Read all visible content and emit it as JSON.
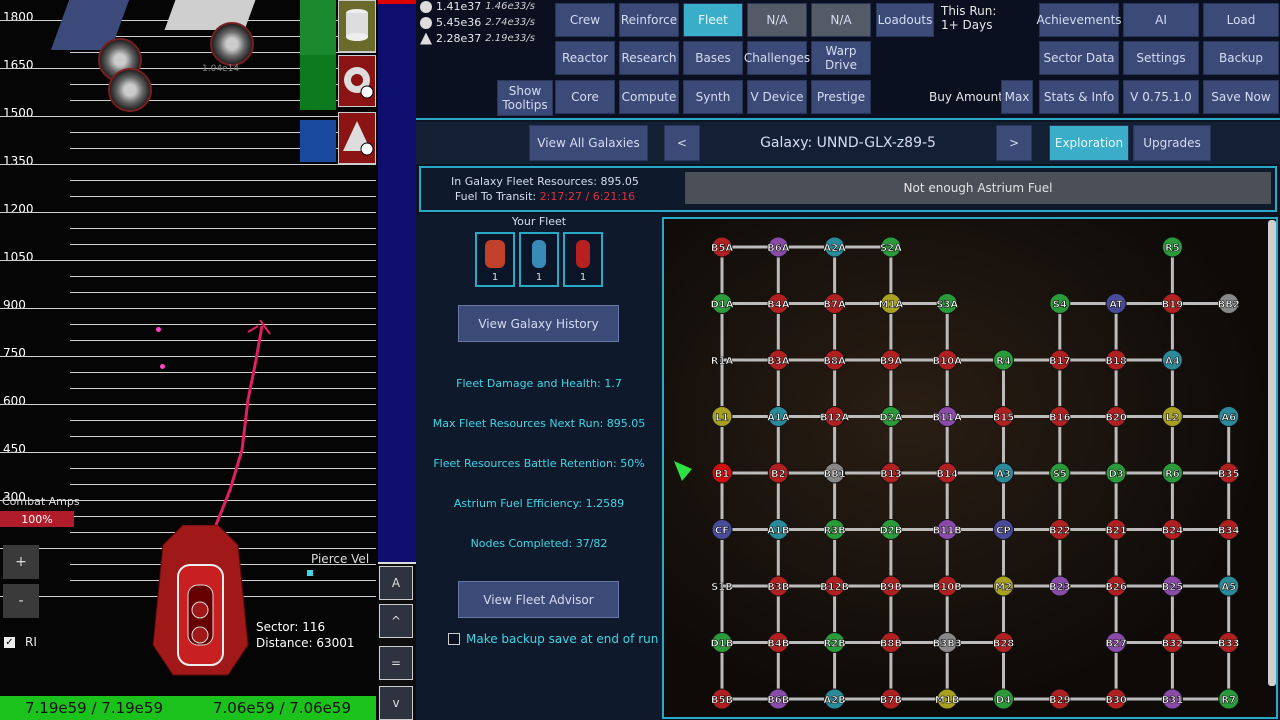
{
  "game": {
    "scale_labels": [
      "1800",
      "1650",
      "1500",
      "1350",
      "1200",
      "1050",
      "900",
      "750",
      "600",
      "450",
      "300"
    ],
    "enemy_hp_text": "1.04e14",
    "combat_amps_label": "Combat Amps",
    "combat_amps_value": "100%",
    "pierce_label": "Pierce Vel",
    "ctrl_plus": "+",
    "ctrl_minus": "-",
    "ri_label": "RI",
    "sector_text": "Sector: 116",
    "distance_text": "Distance: 63001",
    "hp_left": "7.19e59 / 7.19e59",
    "hp_right": "7.06e59 / 7.06e59",
    "side_buttons": [
      "A",
      "^",
      "=",
      "v"
    ]
  },
  "resources": [
    {
      "value": "1.41e37",
      "rate": "1.46e33/s",
      "icon": "database-icon"
    },
    {
      "value": "5.45e36",
      "rate": "2.74e33/s",
      "icon": "ore-icon"
    },
    {
      "value": "2.28e37",
      "rate": "2.19e33/s",
      "icon": "crystal-icon"
    }
  ],
  "nav": {
    "show_tooltips": "Show Tooltips",
    "crew": "Crew",
    "reinforce": "Reinforce",
    "fleet": "Fleet",
    "na1": "N/A",
    "na2": "N/A",
    "loadouts": "Loadouts",
    "reactor": "Reactor",
    "research": "Research",
    "bases": "Bases",
    "challenges": "Challenges",
    "warp_drive": "Warp Drive",
    "core": "Core",
    "compute": "Compute",
    "synth": "Synth",
    "v_device": "V Device",
    "prestige": "Prestige",
    "this_run_label": "This Run:",
    "this_run_value": "1+ Days",
    "achievements": "Achievements",
    "ai": "AI",
    "load": "Load",
    "sector_data": "Sector Data",
    "settings": "Settings",
    "backup": "Backup",
    "buy_amount_label": "Buy Amount:",
    "max": "Max",
    "stats_info": "Stats & Info",
    "version": "V 0.75.1.0",
    "save_now": "Save Now"
  },
  "galaxy": {
    "view_all": "View All Galaxies",
    "prev": "<",
    "title": "Galaxy: UNND-GLX-z89-5",
    "next": ">",
    "exploration": "Exploration",
    "upgrades": "Upgrades",
    "fleet_resources": "In Galaxy Fleet Resources: 895.05",
    "fuel_label": "Fuel To Transit: ",
    "fuel_value": "2:17:27 / 6:21:16",
    "not_enough": "Not enough Astrium Fuel",
    "your_fleet": "Your Fleet",
    "fleet_counts": [
      "1",
      "1",
      "1"
    ],
    "view_history": "View Galaxy History",
    "stats": [
      "Fleet Damage and Health: 1.7",
      "Max Fleet Resources Next Run: 895.05",
      "Fleet Resources Battle Retention: 50%",
      "Astrium Fuel Efficiency: 1.2589",
      "Nodes Completed: 37/82"
    ],
    "view_advisor": "View Fleet Advisor",
    "backup_label": "Make backup save at end of run"
  },
  "map_nodes": [
    {
      "id": "B5A",
      "c": "#b02020",
      "col": 0,
      "row": 0
    },
    {
      "id": "B6A",
      "c": "#8a4aa8",
      "col": 1,
      "row": 0
    },
    {
      "id": "A2A",
      "c": "#2a8a9a",
      "col": 2,
      "row": 0
    },
    {
      "id": "S2A",
      "c": "#2a9a3a",
      "col": 3,
      "row": 0
    },
    {
      "id": "R5",
      "c": "#2a9a3a",
      "col": 8,
      "row": 0
    },
    {
      "id": "D1A",
      "c": "#2a9a3a",
      "col": 0,
      "row": 1
    },
    {
      "id": "B4A",
      "c": "#b02020",
      "col": 1,
      "row": 1
    },
    {
      "id": "B7A",
      "c": "#b02020",
      "col": 2,
      "row": 1
    },
    {
      "id": "M1A",
      "c": "#a8a020",
      "col": 3,
      "row": 1
    },
    {
      "id": "S3A",
      "c": "#2a9a3a",
      "col": 4,
      "row": 1
    },
    {
      "id": "S4",
      "c": "#2a9a3a",
      "col": 6,
      "row": 1
    },
    {
      "id": "AT",
      "c": "#4a4a9a",
      "col": 7,
      "row": 1
    },
    {
      "id": "B19",
      "c": "#b02020",
      "col": 8,
      "row": 1
    },
    {
      "id": "BB2",
      "c": "#888",
      "col": 9,
      "row": 1
    },
    {
      "id": "R1A",
      "c": "none",
      "col": 0,
      "row": 2
    },
    {
      "id": "B3A",
      "c": "#b02020",
      "col": 1,
      "row": 2
    },
    {
      "id": "B8A",
      "c": "#b02020",
      "col": 2,
      "row": 2
    },
    {
      "id": "B9A",
      "c": "#b02020",
      "col": 3,
      "row": 2
    },
    {
      "id": "B10A",
      "c": "#b02020",
      "col": 4,
      "row": 2
    },
    {
      "id": "R4",
      "c": "#2a9a3a",
      "col": 5,
      "row": 2
    },
    {
      "id": "B17",
      "c": "#b02020",
      "col": 6,
      "row": 2
    },
    {
      "id": "B18",
      "c": "#b02020",
      "col": 7,
      "row": 2
    },
    {
      "id": "A4",
      "c": "#2a8a9a",
      "col": 8,
      "row": 2
    },
    {
      "id": "L1",
      "c": "#a8a020",
      "col": 0,
      "row": 3
    },
    {
      "id": "A1A",
      "c": "#2a8a9a",
      "col": 1,
      "row": 3
    },
    {
      "id": "B12A",
      "c": "#b02020",
      "col": 2,
      "row": 3
    },
    {
      "id": "D2A",
      "c": "#2a9a3a",
      "col": 3,
      "row": 3
    },
    {
      "id": "B11A",
      "c": "#8a4aa8",
      "col": 4,
      "row": 3
    },
    {
      "id": "B15",
      "c": "#b02020",
      "col": 5,
      "row": 3
    },
    {
      "id": "B16",
      "c": "#b02020",
      "col": 6,
      "row": 3
    },
    {
      "id": "B20",
      "c": "#b02020",
      "col": 7,
      "row": 3
    },
    {
      "id": "L2",
      "c": "#a8a020",
      "col": 8,
      "row": 3
    },
    {
      "id": "A6",
      "c": "#2a8a9a",
      "col": 9,
      "row": 3
    },
    {
      "id": "B1",
      "c": "#d01010",
      "col": 0,
      "row": 4
    },
    {
      "id": "B2",
      "c": "#b02020",
      "col": 1,
      "row": 4
    },
    {
      "id": "BB1",
      "c": "#888",
      "col": 2,
      "row": 4
    },
    {
      "id": "B13",
      "c": "#b02020",
      "col": 3,
      "row": 4
    },
    {
      "id": "B14",
      "c": "#b02020",
      "col": 4,
      "row": 4
    },
    {
      "id": "A3",
      "c": "#2a8a9a",
      "col": 5,
      "row": 4
    },
    {
      "id": "S5",
      "c": "#2a9a3a",
      "col": 6,
      "row": 4
    },
    {
      "id": "D3",
      "c": "#2a9a3a",
      "col": 7,
      "row": 4
    },
    {
      "id": "R6",
      "c": "#2a9a3a",
      "col": 8,
      "row": 4
    },
    {
      "id": "B35",
      "c": "#b02020",
      "col": 9,
      "row": 4
    },
    {
      "id": "CF",
      "c": "#4a4a9a",
      "col": 0,
      "row": 5
    },
    {
      "id": "A1B",
      "c": "#2a8a9a",
      "col": 1,
      "row": 5
    },
    {
      "id": "R3B",
      "c": "#2a9a3a",
      "col": 2,
      "row": 5
    },
    {
      "id": "D2B",
      "c": "#2a9a3a",
      "col": 3,
      "row": 5
    },
    {
      "id": "B11B",
      "c": "#8a4aa8",
      "col": 4,
      "row": 5
    },
    {
      "id": "CP",
      "c": "#4a4a9a",
      "col": 5,
      "row": 5
    },
    {
      "id": "B22",
      "c": "#b02020",
      "col": 6,
      "row": 5
    },
    {
      "id": "B21",
      "c": "#b02020",
      "col": 7,
      "row": 5
    },
    {
      "id": "B24",
      "c": "#b02020",
      "col": 8,
      "row": 5
    },
    {
      "id": "B34",
      "c": "#b02020",
      "col": 9,
      "row": 5
    },
    {
      "id": "S1B",
      "c": "none",
      "col": 0,
      "row": 6
    },
    {
      "id": "B3B",
      "c": "#b02020",
      "col": 1,
      "row": 6
    },
    {
      "id": "B12B",
      "c": "#b02020",
      "col": 2,
      "row": 6
    },
    {
      "id": "B9B",
      "c": "#b02020",
      "col": 3,
      "row": 6
    },
    {
      "id": "B10B",
      "c": "#b02020",
      "col": 4,
      "row": 6
    },
    {
      "id": "M2",
      "c": "#a8a020",
      "col": 5,
      "row": 6
    },
    {
      "id": "B23",
      "c": "#8a4aa8",
      "col": 6,
      "row": 6
    },
    {
      "id": "B26",
      "c": "#b02020",
      "col": 7,
      "row": 6
    },
    {
      "id": "B25",
      "c": "#8a4aa8",
      "col": 8,
      "row": 6
    },
    {
      "id": "A5",
      "c": "#2a8a9a",
      "col": 9,
      "row": 6
    },
    {
      "id": "D1B",
      "c": "#2a9a3a",
      "col": 0,
      "row": 7
    },
    {
      "id": "B4B",
      "c": "#b02020",
      "col": 1,
      "row": 7
    },
    {
      "id": "R2B",
      "c": "#2a9a3a",
      "col": 2,
      "row": 7
    },
    {
      "id": "B8B",
      "c": "#b02020",
      "col": 3,
      "row": 7
    },
    {
      "id": "B3B3",
      "c": "#888",
      "col": 4,
      "row": 7
    },
    {
      "id": "B28",
      "c": "#b02020",
      "col": 5,
      "row": 7
    },
    {
      "id": "B27",
      "c": "#8a4aa8",
      "col": 7,
      "row": 7
    },
    {
      "id": "B32",
      "c": "#b02020",
      "col": 8,
      "row": 7
    },
    {
      "id": "B33",
      "c": "#b02020",
      "col": 9,
      "row": 7
    },
    {
      "id": "B5B",
      "c": "#b02020",
      "col": 0,
      "row": 8
    },
    {
      "id": "B6B",
      "c": "#8a4aa8",
      "col": 1,
      "row": 8
    },
    {
      "id": "A2B",
      "c": "#2a8a9a",
      "col": 2,
      "row": 8
    },
    {
      "id": "B7B",
      "c": "#b02020",
      "col": 3,
      "row": 8
    },
    {
      "id": "M1B",
      "c": "#a8a020",
      "col": 4,
      "row": 8
    },
    {
      "id": "D4",
      "c": "#2a9a3a",
      "col": 5,
      "row": 8
    },
    {
      "id": "B29",
      "c": "#b02020",
      "col": 6,
      "row": 8
    },
    {
      "id": "B30",
      "c": "#b02020",
      "col": 7,
      "row": 8
    },
    {
      "id": "B31",
      "c": "#8a4aa8",
      "col": 8,
      "row": 8
    },
    {
      "id": "R7",
      "c": "#2a9a3a",
      "col": 9,
      "row": 8
    }
  ],
  "colors": {
    "accent": "#2aa8c8",
    "nav_button": "#3b4a76",
    "active": "#3aaec9",
    "hp_green": "#1cc21c",
    "amps_red": "#b01c2a"
  }
}
